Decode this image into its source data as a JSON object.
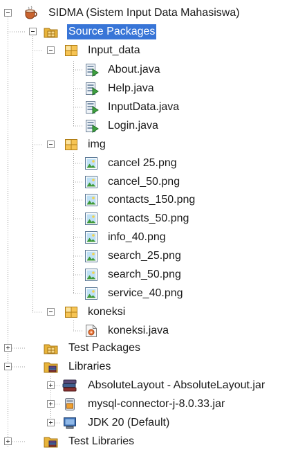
{
  "project": {
    "label": "SIDMA (Sistem Input Data Mahasiswa)",
    "icon": "coffee-cup-icon"
  },
  "source_packages": {
    "label": "Source Packages",
    "icon": "source-packages-icon",
    "packages": [
      {
        "label": "Input_data",
        "icon": "package-icon",
        "files": [
          {
            "label": "About.java",
            "icon": "java-form-icon"
          },
          {
            "label": "Help.java",
            "icon": "java-form-icon"
          },
          {
            "label": "InputData.java",
            "icon": "java-form-icon"
          },
          {
            "label": "Login.java",
            "icon": "java-form-icon"
          }
        ]
      },
      {
        "label": "img",
        "icon": "package-icon",
        "files": [
          {
            "label": "cancel 25.png",
            "icon": "image-file-icon"
          },
          {
            "label": "cancel_50.png",
            "icon": "image-file-icon"
          },
          {
            "label": "contacts_150.png",
            "icon": "image-file-icon"
          },
          {
            "label": "contacts_50.png",
            "icon": "image-file-icon"
          },
          {
            "label": "info_40.png",
            "icon": "image-file-icon"
          },
          {
            "label": "search_25.png",
            "icon": "image-file-icon"
          },
          {
            "label": "search_50.png",
            "icon": "image-file-icon"
          },
          {
            "label": "service_40.png",
            "icon": "image-file-icon"
          }
        ]
      },
      {
        "label": "koneksi",
        "icon": "package-icon",
        "files": [
          {
            "label": "koneksi.java",
            "icon": "java-class-icon"
          }
        ]
      }
    ]
  },
  "test_packages": {
    "label": "Test Packages",
    "icon": "test-packages-icon"
  },
  "libraries": {
    "label": "Libraries",
    "icon": "libraries-folder-icon",
    "items": [
      {
        "label": "AbsoluteLayout - AbsoluteLayout.jar",
        "icon": "library-books-icon"
      },
      {
        "label": "mysql-connector-j-8.0.33.jar",
        "icon": "jar-file-icon"
      },
      {
        "label": "JDK 20 (Default)",
        "icon": "jdk-icon"
      }
    ]
  },
  "test_libraries": {
    "label": "Test Libraries",
    "icon": "libraries-folder-icon"
  },
  "colors": {
    "selection": "#3875d7",
    "tree_line": "#a0a0a0",
    "package": "#f0b030",
    "form_green": "#3ea040"
  }
}
